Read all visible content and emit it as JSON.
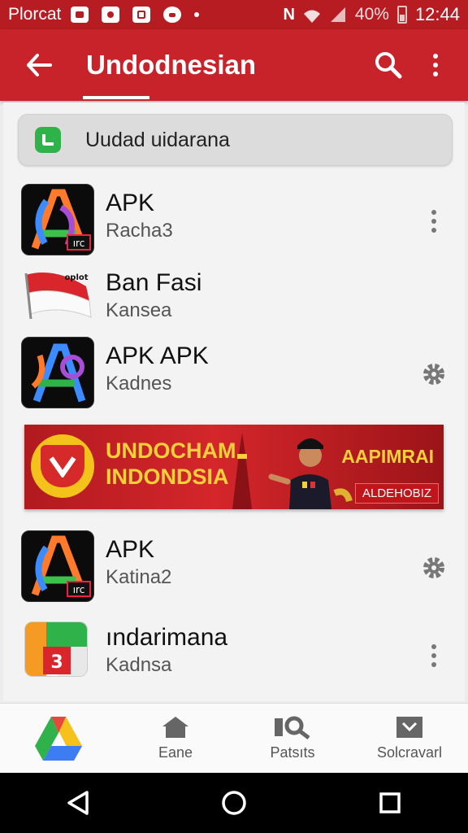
{
  "status_bar": {
    "carrier": "Plorcat",
    "battery_percent": "40%",
    "time": "12:44",
    "nfc": "N"
  },
  "app_bar": {
    "title": "Undodnesian"
  },
  "search": {
    "text": "Uudad uidarana"
  },
  "items": [
    {
      "name": "APK",
      "sub": "Racha3",
      "action": "more-icon"
    },
    {
      "name": "Ban Fasi",
      "sub": "Kansea",
      "action": ""
    },
    {
      "name": "APK APK",
      "sub": "Kadnes",
      "action": "gear-icon"
    },
    {
      "name": "APK",
      "sub": "Katina2",
      "action": "gear-icon"
    },
    {
      "name": "ındarimana",
      "sub": "Kadnsa",
      "action": "more-icon"
    }
  ],
  "app_icon_badges": [
    "ırc",
    "ırc"
  ],
  "flag_label": "oplot",
  "banner": {
    "line1": "UNDOCHAM",
    "line2": "INDONDSIA",
    "right_text": "AAPIMRAI",
    "button": "ALDEHOBIZ"
  },
  "bottom_nav": [
    {
      "label": "",
      "icon": "drive-logo-icon"
    },
    {
      "label": "Eane",
      "icon": "home-icon"
    },
    {
      "label": "Patsıts",
      "icon": "search-tools-icon"
    },
    {
      "label": "Solcravarl",
      "icon": "inbox-icon"
    }
  ],
  "colors": {
    "primary": "#c8232b",
    "status_bar": "#b71c22",
    "accent_green": "#2fb24a"
  },
  "icon_badge_number": "3"
}
